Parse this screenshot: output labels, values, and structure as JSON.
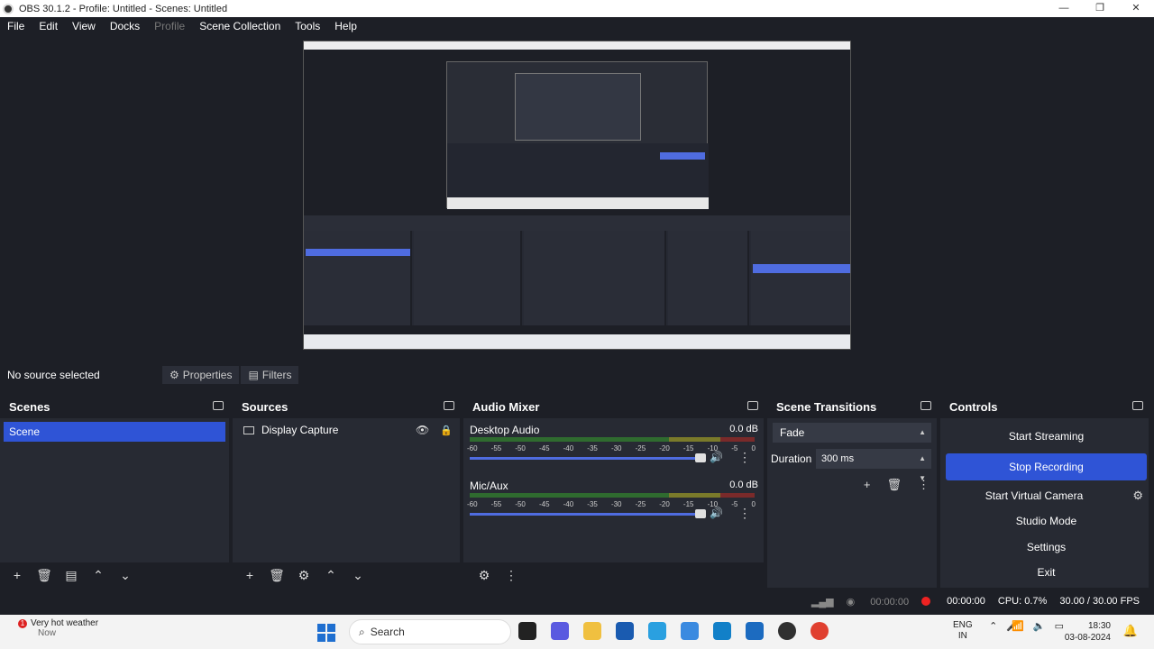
{
  "window": {
    "title": "OBS 30.1.2 - Profile: Untitled - Scenes: Untitled",
    "controls": [
      "—",
      "❐",
      "✕"
    ]
  },
  "menu": {
    "items": [
      "File",
      "Edit",
      "View",
      "Docks",
      "Profile",
      "Scene Collection",
      "Tools",
      "Help"
    ]
  },
  "source_toolbar": {
    "no_source": "No source selected",
    "properties": "Properties",
    "filters": "Filters"
  },
  "scenes": {
    "title": "Scenes",
    "items": [
      "Scene"
    ]
  },
  "sources": {
    "title": "Sources",
    "items": [
      "Display Capture"
    ]
  },
  "mixer": {
    "title": "Audio Mixer",
    "channels": [
      {
        "name": "Desktop Audio",
        "db": "0.0 dB",
        "volume": 1.0
      },
      {
        "name": "Mic/Aux",
        "db": "0.0 dB",
        "volume": 1.0
      }
    ],
    "ticks": [
      "-60",
      "-55",
      "-50",
      "-45",
      "-40",
      "-35",
      "-30",
      "-25",
      "-20",
      "-15",
      "-10",
      "-5",
      "0"
    ]
  },
  "transitions": {
    "title": "Scene Transitions",
    "selected": "Fade",
    "duration_label": "Duration",
    "duration": "300 ms"
  },
  "controls": {
    "title": "Controls",
    "start_streaming": "Start Streaming",
    "stop_recording": "Stop Recording",
    "start_virtual_camera": "Start Virtual Camera",
    "studio_mode": "Studio Mode",
    "settings": "Settings",
    "exit": "Exit"
  },
  "status": {
    "stream_time": "00:00:00",
    "rec_time": "00:00:00",
    "cpu": "CPU: 0.7%",
    "fps": "30.00 / 30.00 FPS"
  },
  "taskbar": {
    "weather_badge": "1",
    "weather": "Very hot weather",
    "weather_sub": "Now",
    "search": "Search",
    "lang_1": "ENG",
    "lang_2": "IN",
    "time": "18:30",
    "date": "03-08-2024"
  },
  "colors": {
    "accent": "#2f54d6",
    "background": "#1d1f26",
    "panel": "#272a33",
    "record": "#e22222"
  }
}
